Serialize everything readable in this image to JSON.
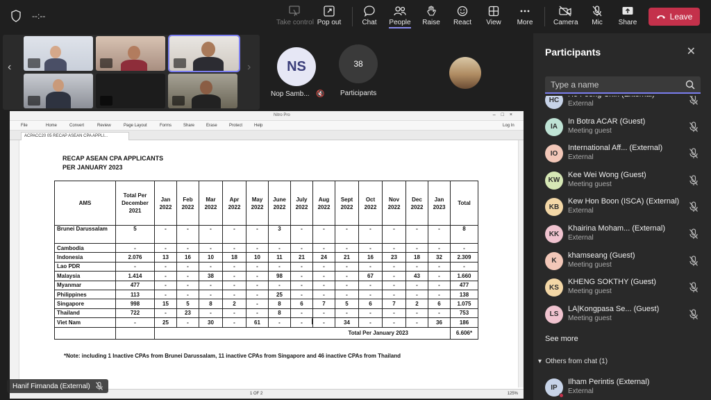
{
  "meeting": {
    "timer": "--:--"
  },
  "toolbar": {
    "take_control": "Take control",
    "pop_out": "Pop out",
    "chat": "Chat",
    "people": "People",
    "raise": "Raise",
    "react": "React",
    "view": "View",
    "more": "More",
    "camera": "Camera",
    "mic": "Mic",
    "share": "Share",
    "leave": "Leave"
  },
  "gallery": {
    "ns_initials": "NS",
    "ns_name": "Nop Samb...",
    "participant_count": "38",
    "participants_label": "Participants"
  },
  "presenter": {
    "name": "Hanif Firnanda (External)"
  },
  "nitro": {
    "window_title": "Nitro Pro",
    "menu": [
      "File",
      "Home",
      "Convert",
      "Review",
      "Page Layout",
      "Forms",
      "Share",
      "Erase",
      "Protect",
      "Help"
    ],
    "login": "Log In",
    "tab": "ACPACC20 05 RECAP ASEAN CPA APPLI...",
    "page": "1 OF 2",
    "zoom": "125%"
  },
  "document": {
    "title_line1": "RECAP ASEAN CPA APPLICANTS",
    "title_line2": "PER JANUARY 2023",
    "headers": [
      "AMS",
      "Total Per December 2021",
      "Jan 2022",
      "Feb 2022",
      "Mar 2022",
      "Apr 2022",
      "May 2022",
      "June 2022",
      "July 2022",
      "Aug 2022",
      "Sept 2022",
      "Oct 2022",
      "Nov 2022",
      "Dec 2022",
      "Jan 2023",
      "Total"
    ],
    "rows": [
      [
        "Brunei Darussalam",
        "5",
        "-",
        "-",
        "-",
        "-",
        "-",
        "3",
        "-",
        "-",
        "-",
        "-",
        "-",
        "-",
        "-",
        "8"
      ],
      [
        "Cambodia",
        "-",
        "-",
        "-",
        "-",
        "-",
        "-",
        "-",
        "-",
        "-",
        "-",
        "-",
        "-",
        "-",
        "-",
        "-"
      ],
      [
        "Indonesia",
        "2.076",
        "13",
        "16",
        "10",
        "18",
        "10",
        "11",
        "21",
        "24",
        "21",
        "16",
        "23",
        "18",
        "32",
        "2.309"
      ],
      [
        "Lao PDR",
        "-",
        "-",
        "-",
        "-",
        "-",
        "-",
        "-",
        "-",
        "-",
        "-",
        "-",
        "-",
        "-",
        "-",
        "-"
      ],
      [
        "Malaysia",
        "1.414",
        "-",
        "-",
        "38",
        "-",
        "-",
        "98",
        "-",
        "-",
        "-",
        "67",
        "-",
        "43",
        "-",
        "1.660"
      ],
      [
        "Myanmar",
        "477",
        "-",
        "-",
        "-",
        "-",
        "-",
        "-",
        "-",
        "-",
        "-",
        "-",
        "-",
        "-",
        "-",
        "477"
      ],
      [
        "Philippines",
        "113",
        "-",
        "-",
        "-",
        "-",
        "-",
        "25",
        "-",
        "-",
        "-",
        "-",
        "-",
        "-",
        "-",
        "138"
      ],
      [
        "Singapore",
        "998",
        "15",
        "5",
        "8",
        "2",
        "-",
        "8",
        "6",
        "7",
        "5",
        "6",
        "7",
        "2",
        "6",
        "1.075"
      ],
      [
        "Thailand",
        "722",
        "-",
        "23",
        "-",
        "-",
        "-",
        "8",
        "-",
        "-",
        "-",
        "-",
        "-",
        "-",
        "-",
        "753"
      ],
      [
        "Viet Nam",
        "-",
        "25",
        "-",
        "30",
        "-",
        "61",
        "-",
        "-",
        "-",
        "34",
        "-",
        "-",
        "-",
        "36",
        "186"
      ]
    ],
    "total_label": "Total Per January 2023",
    "total_value": "6.606*",
    "note": "*Note: including 1 Inactive CPAs from Brunei Darussalam, 11 inactive CPAs from Singapore and 46 inactive CPAs from Thailand"
  },
  "panel": {
    "title": "Participants",
    "search_placeholder": "Type a name",
    "participants": [
      {
        "initials": "HC",
        "name": "Ho Foong Chin (External)",
        "role": "External",
        "color": "#c7d3e8"
      },
      {
        "initials": "IA",
        "name": "In Botra ACAR (Guest)",
        "role": "Meeting guest",
        "color": "#bfe3d5"
      },
      {
        "initials": "IO",
        "name": "International Aff... (External)",
        "role": "External",
        "color": "#f2c7b8"
      },
      {
        "initials": "KW",
        "name": "Kee Wei Wong (Guest)",
        "role": "Meeting guest",
        "color": "#d6e7b5"
      },
      {
        "initials": "KB",
        "name": "Kew Hon Boon (ISCA) (External)",
        "role": "External",
        "color": "#f3d7a6"
      },
      {
        "initials": "KK",
        "name": "Khairina Moham... (External)",
        "role": "External",
        "color": "#f0c3cf"
      },
      {
        "initials": "K",
        "name": "khamseang (Guest)",
        "role": "Meeting guest",
        "color": "#f2c7b8"
      },
      {
        "initials": "KS",
        "name": "KHENG SOKTHY (Guest)",
        "role": "Meeting guest",
        "color": "#f3d7a6"
      },
      {
        "initials": "LS",
        "name": "LA|Kongpasa Se... (Guest)",
        "role": "Meeting guest",
        "color": "#f0c3cf"
      }
    ],
    "see_more": "See more",
    "others_section": "Others from chat (1)",
    "chat_participant": {
      "initials": "IP",
      "name": "Ilham Perintis (External)",
      "role": "External",
      "color": "#c7d3e8"
    }
  }
}
